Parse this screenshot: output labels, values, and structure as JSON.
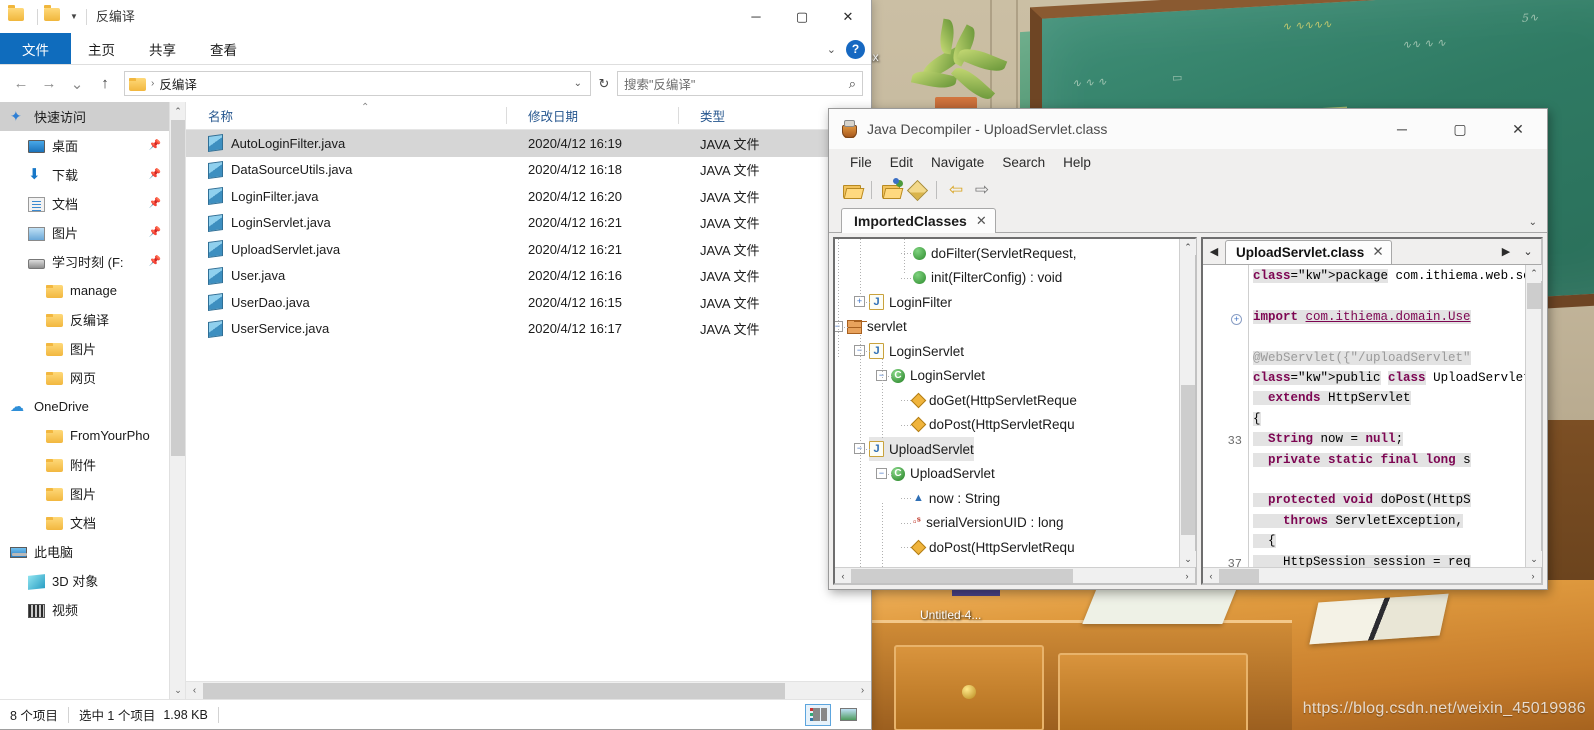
{
  "desktop": {
    "icon_label_partial": "ocx",
    "window_label": "Untitled-4...",
    "watermark": "https://blog.csdn.net/weixin_45019986"
  },
  "explorer": {
    "title": "反编译",
    "titlebar_icons": [
      "folder-icon",
      "folder-icon",
      "dropdown-caret-icon"
    ],
    "window_buttons": {
      "minimize": "─",
      "maximize": "▢",
      "close": "✕"
    },
    "ribbon_tabs": [
      {
        "label": "文件",
        "active": true
      },
      {
        "label": "主页",
        "active": false
      },
      {
        "label": "共享",
        "active": false
      },
      {
        "label": "查看",
        "active": false
      }
    ],
    "ribbon_caret": "⌄",
    "help_glyph": "?",
    "nav": {
      "back": "←",
      "forward": "→",
      "recent": "⌄",
      "up": "↑",
      "address_value": "反编译",
      "address_separator": "›",
      "address_dropdown": "⌄",
      "refresh": "↻",
      "search_placeholder": "搜索\"反编译\"",
      "search_icon": "⌕"
    },
    "navpane": {
      "items": [
        {
          "label": "快速访问",
          "icon": "star-icon",
          "selected": true,
          "indent": 0,
          "pin": false
        },
        {
          "label": "桌面",
          "icon": "desktop-icon",
          "selected": false,
          "indent": 1,
          "pin": true
        },
        {
          "label": "下载",
          "icon": "download-icon",
          "selected": false,
          "indent": 1,
          "pin": true
        },
        {
          "label": "文档",
          "icon": "document-icon",
          "selected": false,
          "indent": 1,
          "pin": true
        },
        {
          "label": "图片",
          "icon": "picture-icon",
          "selected": false,
          "indent": 1,
          "pin": true
        },
        {
          "label": "学习时刻 (F:",
          "icon": "drive-icon",
          "selected": false,
          "indent": 1,
          "pin": true
        },
        {
          "label": "manage",
          "icon": "folder-icon",
          "selected": false,
          "indent": 2,
          "pin": false
        },
        {
          "label": "反编译",
          "icon": "folder-icon",
          "selected": false,
          "indent": 2,
          "pin": false
        },
        {
          "label": "图片",
          "icon": "folder-icon",
          "selected": false,
          "indent": 2,
          "pin": false
        },
        {
          "label": "网页",
          "icon": "folder-icon",
          "selected": false,
          "indent": 2,
          "pin": false
        },
        {
          "label": "OneDrive",
          "icon": "onedrive-icon",
          "selected": false,
          "indent": 0,
          "pin": false
        },
        {
          "label": "FromYourPho",
          "icon": "folder-icon",
          "selected": false,
          "indent": 2,
          "pin": false
        },
        {
          "label": "附件",
          "icon": "folder-icon",
          "selected": false,
          "indent": 2,
          "pin": false
        },
        {
          "label": "图片",
          "icon": "folder-icon",
          "selected": false,
          "indent": 2,
          "pin": false
        },
        {
          "label": "文档",
          "icon": "folder-icon",
          "selected": false,
          "indent": 2,
          "pin": false
        },
        {
          "label": "此电脑",
          "icon": "pc-icon",
          "selected": false,
          "indent": 0,
          "pin": false
        },
        {
          "label": "3D 对象",
          "icon": "3d-icon",
          "selected": false,
          "indent": 1,
          "pin": false
        },
        {
          "label": "视频",
          "icon": "video-icon",
          "selected": false,
          "indent": 1,
          "pin": false
        }
      ],
      "scroll_up": "⌃",
      "scroll_down": "⌄"
    },
    "columns": [
      {
        "key": "name",
        "label": "名称",
        "sorted": true,
        "sort_glyph": "⌃"
      },
      {
        "key": "date",
        "label": "修改日期",
        "sorted": false
      },
      {
        "key": "type",
        "label": "类型",
        "sorted": false
      }
    ],
    "files": [
      {
        "name": "AutoLoginFilter.java",
        "date": "2020/4/12 16:19",
        "type": "JAVA 文件",
        "selected": true
      },
      {
        "name": "DataSourceUtils.java",
        "date": "2020/4/12 16:18",
        "type": "JAVA 文件",
        "selected": false
      },
      {
        "name": "LoginFilter.java",
        "date": "2020/4/12 16:20",
        "type": "JAVA 文件",
        "selected": false
      },
      {
        "name": "LoginServlet.java",
        "date": "2020/4/12 16:21",
        "type": "JAVA 文件",
        "selected": false
      },
      {
        "name": "UploadServlet.java",
        "date": "2020/4/12 16:21",
        "type": "JAVA 文件",
        "selected": false
      },
      {
        "name": "User.java",
        "date": "2020/4/12 16:16",
        "type": "JAVA 文件",
        "selected": false
      },
      {
        "name": "UserDao.java",
        "date": "2020/4/12 16:15",
        "type": "JAVA 文件",
        "selected": false
      },
      {
        "name": "UserService.java",
        "date": "2020/4/12 16:17",
        "type": "JAVA 文件",
        "selected": false
      }
    ],
    "hscroll": {
      "left": "‹",
      "right": "›"
    },
    "status": {
      "count": "8 个项目",
      "selection": "选中 1 个项目",
      "size": "1.98 KB",
      "views": [
        {
          "name": "details-view",
          "active": true
        },
        {
          "name": "thumbnail-view",
          "active": false
        }
      ]
    }
  },
  "decompiler": {
    "title": "Java Decompiler - UploadServlet.class",
    "app_icon": "coffee-cup-icon",
    "window_buttons": {
      "minimize": "─",
      "maximize": "▢",
      "close": "✕"
    },
    "menu": [
      "File",
      "Edit",
      "Navigate",
      "Search",
      "Help"
    ],
    "toolbar": [
      {
        "name": "open-file-icon"
      },
      {
        "name": "open-type-icon"
      },
      {
        "name": "edit-pencil-icon"
      },
      {
        "name": "back-arrow-icon"
      },
      {
        "name": "forward-arrow-icon"
      }
    ],
    "tab": {
      "label": "ImportedClasses",
      "close": "✕"
    },
    "tabrow_caret": "⌄",
    "tree": [
      {
        "label": "doFilter(ServletRequest,",
        "icon": "method-circle-icon",
        "depth": 5,
        "twisty": null
      },
      {
        "label": "init(FilterConfig) : void",
        "icon": "method-circle-icon",
        "depth": 5,
        "twisty": null
      },
      {
        "label": "LoginFilter",
        "icon": "java-file-icon",
        "depth": 3,
        "twisty": "+"
      },
      {
        "label": "servlet",
        "icon": "package-icon",
        "depth": 2,
        "twisty": "−"
      },
      {
        "label": "LoginServlet",
        "icon": "java-file-icon",
        "depth": 3,
        "twisty": "−"
      },
      {
        "label": "LoginServlet",
        "icon": "class-icon",
        "depth": 4,
        "twisty": "−"
      },
      {
        "label": "doGet(HttpServletReque",
        "icon": "method-diamond-icon",
        "depth": 5,
        "twisty": null
      },
      {
        "label": "doPost(HttpServletRequ",
        "icon": "method-diamond-icon",
        "depth": 5,
        "twisty": null
      },
      {
        "label": "UploadServlet",
        "icon": "java-file-icon",
        "depth": 3,
        "twisty": "−",
        "selected": true
      },
      {
        "label": "UploadServlet",
        "icon": "class-icon",
        "depth": 4,
        "twisty": "−"
      },
      {
        "label": "now : String",
        "icon": "field-triangle-icon",
        "depth": 5,
        "twisty": null
      },
      {
        "label": "serialVersionUID : long",
        "icon": "static-field-icon",
        "depth": 5,
        "twisty": null
      },
      {
        "label": "doPost(HttpServletRequ",
        "icon": "method-diamond-icon",
        "depth": 5,
        "twisty": null
      }
    ],
    "tree_scroll": {
      "up": "⌃",
      "down": "⌄",
      "left": "‹",
      "right": "›"
    },
    "code_tab": {
      "label": "UploadServlet.class",
      "close": "✕",
      "prev": "◀",
      "next": "▶",
      "menu": "⌄"
    },
    "code_lines": [
      {
        "num": "",
        "fold": null,
        "text": "package com.ithiema.web.servl"
      },
      {
        "num": "",
        "fold": null,
        "text": ""
      },
      {
        "num": "",
        "fold": "+",
        "text": "import com.ithiema.domain.Use"
      },
      {
        "num": "",
        "fold": null,
        "text": ""
      },
      {
        "num": "",
        "fold": null,
        "text": "@WebServlet({\"/uploadServlet\""
      },
      {
        "num": "",
        "fold": null,
        "text": "public class UploadServlet"
      },
      {
        "num": "",
        "fold": null,
        "text": "  extends HttpServlet"
      },
      {
        "num": "",
        "fold": null,
        "text": "{"
      },
      {
        "num": "33",
        "fold": null,
        "text": "  String now = null;"
      },
      {
        "num": "",
        "fold": null,
        "text": "  private static final long s"
      },
      {
        "num": "",
        "fold": null,
        "text": ""
      },
      {
        "num": "",
        "fold": null,
        "text": "  protected void doPost(HttpS"
      },
      {
        "num": "",
        "fold": null,
        "text": "    throws ServletException,"
      },
      {
        "num": "",
        "fold": null,
        "text": "  {"
      },
      {
        "num": "37",
        "fold": null,
        "text": "    HttpSession session = req"
      }
    ],
    "code_scroll": {
      "up": "⌃",
      "down": "⌄",
      "left": "‹",
      "right": "›"
    }
  },
  "colors": {
    "accent_blue": "#0f6cbd",
    "selection_gray": "#d6d6d6",
    "column_header_text": "#27578f",
    "chalkboard_green": "#2f7a63",
    "desk_wood": "#c77d2c"
  }
}
